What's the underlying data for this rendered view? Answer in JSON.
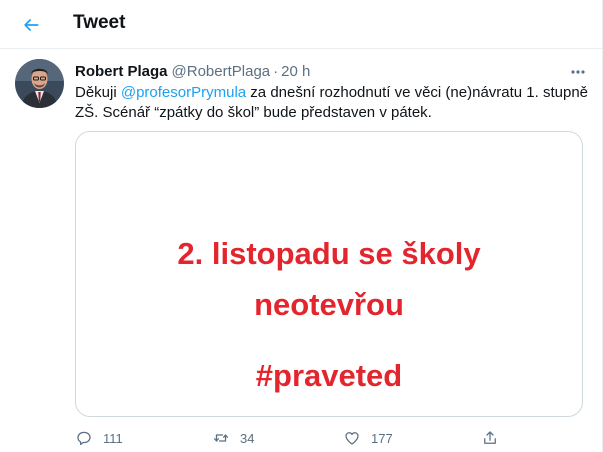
{
  "header": {
    "title": "Tweet",
    "back_icon": "arrow-left-icon"
  },
  "tweet": {
    "author_name": "Robert Plaga",
    "author_handle": "@RobertPlaga",
    "separator": "·",
    "time": "20 h",
    "text_before": "Děkuji ",
    "mention": "@profesorPrymula",
    "text_after": " za dnešní rozhodnutí ve věci (ne)návratu 1. stupně ZŠ. Scénář “zpátky do škol” bude představen v pátek.",
    "media": {
      "line1": "2. listopadu se školy",
      "line2": "neotevřou",
      "hashtag": "#praveted",
      "text_color": "#e3262e"
    },
    "actions": {
      "reply_count": "111",
      "retweet_count": "34",
      "like_count": "177"
    }
  },
  "colors": {
    "accent": "#1da1f2",
    "secondary_text": "#5b7083",
    "border": "#ebeef0"
  }
}
